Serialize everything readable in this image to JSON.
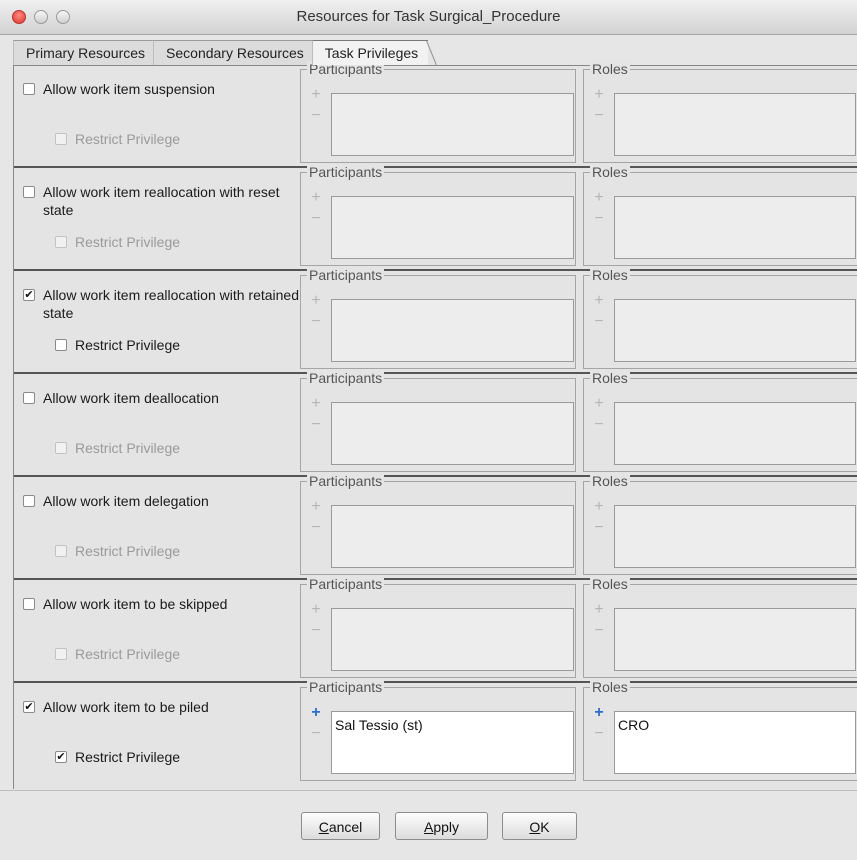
{
  "window": {
    "title": "Resources for Task Surgical_Procedure"
  },
  "tabs": [
    {
      "label": "Primary Resources",
      "active": false
    },
    {
      "label": "Secondary Resources",
      "active": false
    },
    {
      "label": "Task Privileges",
      "active": true
    }
  ],
  "privileges": [
    {
      "label": "Allow work item suspension",
      "checked": false,
      "restrict_label": "Restrict Privilege",
      "restrict_checked": false,
      "restrict_enabled": false,
      "participants_title": "Participants",
      "roles_title": "Roles",
      "participants": [],
      "roles": []
    },
    {
      "label": "Allow work item reallocation with reset state",
      "checked": false,
      "restrict_label": "Restrict Privilege",
      "restrict_checked": false,
      "restrict_enabled": false,
      "participants_title": "Participants",
      "roles_title": "Roles",
      "participants": [],
      "roles": []
    },
    {
      "label": "Allow work item reallocation with retained state",
      "checked": true,
      "restrict_label": "Restrict Privilege",
      "restrict_checked": false,
      "restrict_enabled": true,
      "participants_title": "Participants",
      "roles_title": "Roles",
      "participants": [],
      "roles": []
    },
    {
      "label": "Allow work item deallocation",
      "checked": false,
      "restrict_label": "Restrict Privilege",
      "restrict_checked": false,
      "restrict_enabled": false,
      "participants_title": "Participants",
      "roles_title": "Roles",
      "participants": [],
      "roles": []
    },
    {
      "label": "Allow work item delegation",
      "checked": false,
      "restrict_label": "Restrict Privilege",
      "restrict_checked": false,
      "restrict_enabled": false,
      "participants_title": "Participants",
      "roles_title": "Roles",
      "participants": [],
      "roles": []
    },
    {
      "label": "Allow work item to be skipped",
      "checked": false,
      "restrict_label": "Restrict Privilege",
      "restrict_checked": false,
      "restrict_enabled": false,
      "participants_title": "Participants",
      "roles_title": "Roles",
      "participants": [],
      "roles": []
    },
    {
      "label": "Allow work item to be piled",
      "checked": true,
      "restrict_label": "Restrict Privilege",
      "restrict_checked": true,
      "restrict_enabled": true,
      "participants_title": "Participants",
      "roles_title": "Roles",
      "participants": [
        "Sal Tessio (st)"
      ],
      "roles": [
        "CRO"
      ]
    }
  ],
  "footer": {
    "cancel_label": "Cancel",
    "apply_label": "Apply",
    "ok_label": "OK"
  }
}
